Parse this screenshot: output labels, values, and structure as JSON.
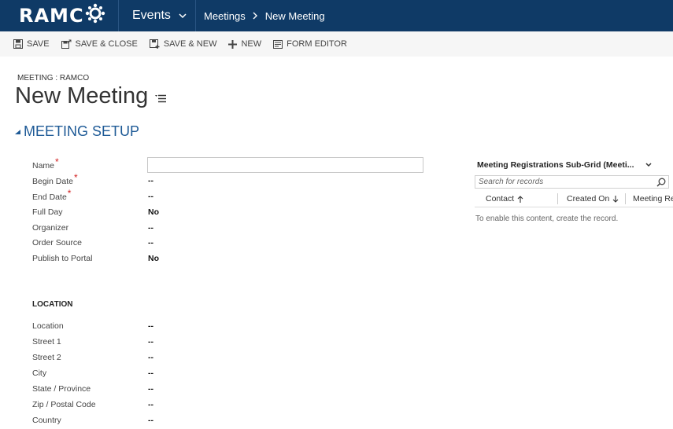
{
  "nav": {
    "logo": "RAMCO",
    "area": "Events",
    "breadcrumb_1": "Meetings",
    "breadcrumb_2": "New Meeting"
  },
  "commands": {
    "save": "SAVE",
    "save_close": "SAVE & CLOSE",
    "save_new": "SAVE & NEW",
    "new": "NEW",
    "form_editor": "FORM EDITOR"
  },
  "form": {
    "entity_label": "MEETING : RAMCO",
    "title": "New Meeting",
    "section": "MEETING SETUP"
  },
  "fields": [
    {
      "label": "Name",
      "value": "",
      "required": "*"
    },
    {
      "label": "Begin Date",
      "value": "--",
      "required": "*"
    },
    {
      "label": "End Date",
      "value": "--",
      "required": "*"
    },
    {
      "label": "Full Day",
      "value": "No",
      "required": ""
    },
    {
      "label": "Organizer",
      "value": "--",
      "required": ""
    },
    {
      "label": "Order Source",
      "value": "--",
      "required": ""
    },
    {
      "label": "Publish to Portal",
      "value": "No",
      "required": ""
    }
  ],
  "location": {
    "heading": "LOCATION",
    "fields": [
      {
        "label": "Location",
        "value": "--"
      },
      {
        "label": "Street 1",
        "value": "--"
      },
      {
        "label": "Street 2",
        "value": "--"
      },
      {
        "label": "City",
        "value": "--"
      },
      {
        "label": "State / Province",
        "value": "--"
      },
      {
        "label": "Zip / Postal Code",
        "value": "--"
      },
      {
        "label": "Country",
        "value": "--"
      }
    ]
  },
  "subgrid": {
    "title": "Meeting Registrations Sub-Grid (Meeti...",
    "search_placeholder": "Search for records",
    "columns": [
      "Contact",
      "Created On",
      "Meeting Re"
    ],
    "empty_message": "To enable this content, create the record."
  },
  "colors": {
    "topbar": "#0f3a66",
    "section": "#1e5a96",
    "required": "#d21f1f"
  }
}
